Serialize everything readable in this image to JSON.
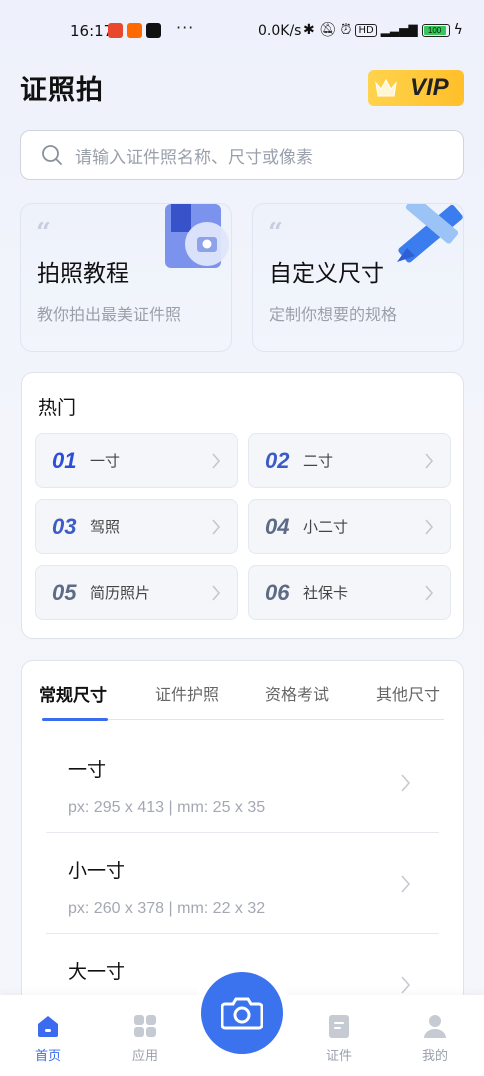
{
  "status_bar": {
    "time": "16:17",
    "more": "···",
    "speed": "0.0K/s",
    "battery": "100"
  },
  "header": {
    "title": "证照拍",
    "vip_label": "VIP"
  },
  "search": {
    "placeholder": "请输入证件照名称、尺寸或像素"
  },
  "features": [
    {
      "title": "拍照教程",
      "subtitle": "教你拍出最美证件照"
    },
    {
      "title": "自定义尺寸",
      "subtitle": "定制你想要的规格"
    }
  ],
  "hot": {
    "title": "热门",
    "items": [
      {
        "num": "01",
        "label": "一寸"
      },
      {
        "num": "02",
        "label": "二寸"
      },
      {
        "num": "03",
        "label": "驾照"
      },
      {
        "num": "04",
        "label": "小二寸"
      },
      {
        "num": "05",
        "label": "简历照片"
      },
      {
        "num": "06",
        "label": "社保卡"
      }
    ]
  },
  "size_tabs": [
    "常规尺寸",
    "证件护照",
    "资格考试",
    "其他尺寸"
  ],
  "size_list": [
    {
      "name": "一寸",
      "spec": "px: 295 x 413 | mm: 25 x 35"
    },
    {
      "name": "小一寸",
      "spec": "px: 260 x 378 | mm: 22 x 32"
    },
    {
      "name": "大一寸",
      "spec": ""
    }
  ],
  "nav": [
    {
      "label": "首页",
      "icon": "home-icon"
    },
    {
      "label": "应用",
      "icon": "grid-icon"
    },
    {
      "label": "证件",
      "icon": "document-icon"
    },
    {
      "label": "我的",
      "icon": "user-icon"
    }
  ],
  "colors": {
    "accent": "#3b6cf0",
    "vip": "#ffc93a",
    "hot_num_primary": "#2d4fd8",
    "hot_num_secondary": "#5d6b86"
  }
}
